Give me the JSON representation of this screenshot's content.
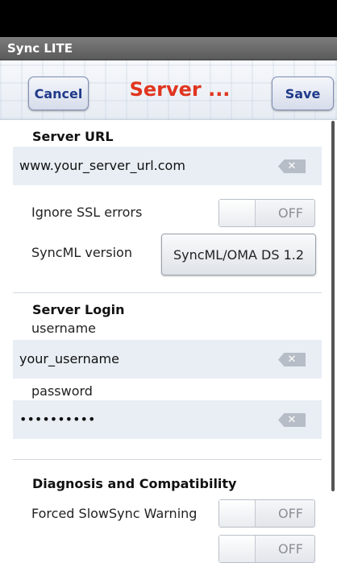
{
  "app": {
    "title": "Sync LITE"
  },
  "toolbar": {
    "cancel_label": "Cancel",
    "title": "Server ...",
    "save_label": "Save"
  },
  "server_url": {
    "section_title": "Server URL",
    "url_value": "www.your_server_url.com",
    "ignore_ssl_label": "Ignore SSL errors",
    "ignore_ssl_state": "OFF",
    "syncml_label": "SyncML version",
    "syncml_value": "SyncML/OMA DS 1.2"
  },
  "server_login": {
    "section_title": "Server Login",
    "username_label": "username",
    "username_value": "your_username",
    "password_label": "password",
    "password_value": "••••••••••"
  },
  "diagnosis": {
    "section_title": "Diagnosis and Compatibility",
    "slowsync_label": "Forced SlowSync Warning",
    "slowsync_state": "OFF",
    "next_state": "OFF"
  },
  "icons": {
    "clear": "clear-text-icon",
    "scrollbar": "scrollbar"
  }
}
